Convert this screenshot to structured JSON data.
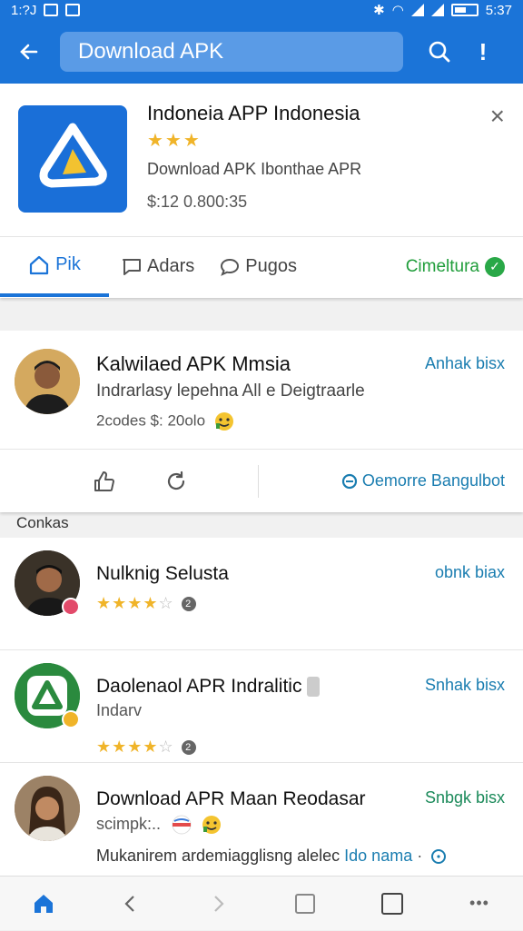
{
  "status_bar": {
    "time_left": "1:?J",
    "time_right": "5:37"
  },
  "app_bar": {
    "search_text": "Download APK",
    "more_glyph": "!"
  },
  "hero": {
    "title": "Indoneia APP Indonesia",
    "stars": "★★★",
    "subtitle": "Download APK Ibonthae APR",
    "price": "$:12 0.800:35",
    "close": "×"
  },
  "tabs": [
    {
      "label": "Pik",
      "icon": "home-outline-icon"
    },
    {
      "label": "Adars",
      "icon": "message-square-icon"
    },
    {
      "label": "Pugos",
      "icon": "chat-bubble-icon"
    }
  ],
  "tab_status": {
    "label": "Cimeltura",
    "check": "✓"
  },
  "featured": {
    "name": "Kalwilaed APK Mmsia",
    "description": "Indrarlasy lepehna All e Deigtraarle",
    "meta": "2codes  $: 20olo",
    "link": "Anhak bisx",
    "action_link": "Oemorre Bangulbot"
  },
  "section_label": "Conkas",
  "list": [
    {
      "name": "Nulknig Selusta",
      "rating": 4,
      "count": "2",
      "link": "obnk biax"
    },
    {
      "name": "Daolenaol APR Indralitic",
      "sub": "Indarv",
      "rating": 4,
      "count": "2",
      "link": "Snhak bisx"
    },
    {
      "name": "Download APR Maan Reodasar",
      "sub": "scimpk:..",
      "link": "Snbgk bisx",
      "footer": "Mukanirem ardemiagglisng alelec",
      "footer_link": "Ido nama"
    }
  ],
  "colors": {
    "primary": "#1b74d8",
    "star": "#f0b429",
    "success": "#29a847",
    "link": "#1a7db0"
  }
}
